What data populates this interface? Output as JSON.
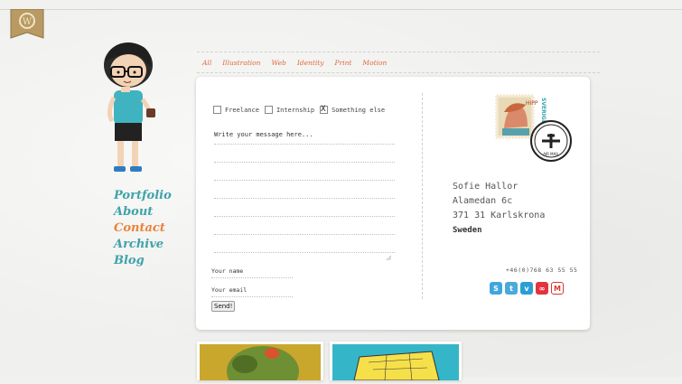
{
  "filters": [
    "All",
    "Illustration",
    "Web",
    "Identity",
    "Print",
    "Motion"
  ],
  "nav": [
    {
      "label": "Portfolio",
      "active": false
    },
    {
      "label": "About",
      "active": false
    },
    {
      "label": "Contact",
      "active": true
    },
    {
      "label": "Archive",
      "active": false
    },
    {
      "label": "Blog",
      "active": false
    }
  ],
  "form": {
    "checkboxes": [
      {
        "label": "Freelance",
        "checked": false
      },
      {
        "label": "Internship",
        "checked": false
      },
      {
        "label": "Something else",
        "checked": true
      }
    ],
    "message_placeholder": "Write your message here...",
    "name_label": "Your name",
    "email_label": "Your email",
    "send_label": "Send!"
  },
  "address": {
    "name": "Sofie Hallor",
    "street": "Alamedan 6c",
    "city": "371 31 Karlskrona",
    "country": "Sweden"
  },
  "phone": "+46(0)768 63 55 55",
  "socials": [
    {
      "icon": "skype-icon",
      "glyph": "S",
      "color": "#3fa7dd"
    },
    {
      "icon": "twitter-icon",
      "glyph": "t",
      "color": "#4aaad9"
    },
    {
      "icon": "vimeo-icon",
      "glyph": "v",
      "color": "#2a9fd3"
    },
    {
      "icon": "lastfm-icon",
      "glyph": "∞",
      "color": "#e2333e"
    },
    {
      "icon": "gmail-icon",
      "glyph": "M",
      "color": "#ffffff"
    }
  ],
  "stamp": {
    "hipp": "HIPP",
    "sverige": "SVERIGE",
    "postmark": "AIR MAIL"
  }
}
